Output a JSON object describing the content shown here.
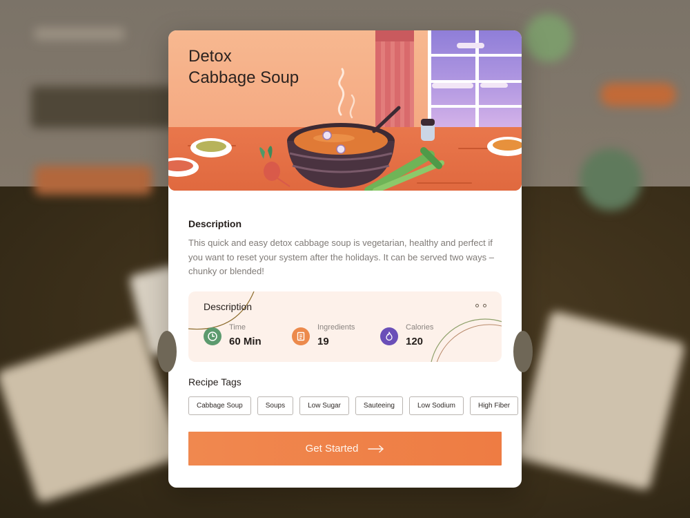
{
  "recipe": {
    "title_line1": "Detox",
    "title_line2": "Cabbage Soup"
  },
  "description": {
    "heading": "Description",
    "text": "This quick and easy detox cabbage soup is vegetarian, healthy and perfect if you want to reset your system after the holidays. It can be served two ways – chunky or blended!"
  },
  "info": {
    "heading": "Description",
    "stats": [
      {
        "label": "Time",
        "value": "60 Min",
        "icon": "clock-icon",
        "color": "#5c9a6e"
      },
      {
        "label": "Ingredients",
        "value": "19",
        "icon": "notebook-icon",
        "color": "#ec8a4c"
      },
      {
        "label": "Calories",
        "value": "120",
        "icon": "flame-icon",
        "color": "#6a4fb8"
      }
    ]
  },
  "tags": {
    "heading": "Recipe Tags",
    "items": [
      "Cabbage Soup",
      "Soups",
      "Low Sugar",
      "Sauteeing",
      "Low Sodium",
      "High Fiber"
    ]
  },
  "cta": {
    "label": "Get Started",
    "color": "#ee7c43",
    "icon": "arrow-right-icon"
  }
}
